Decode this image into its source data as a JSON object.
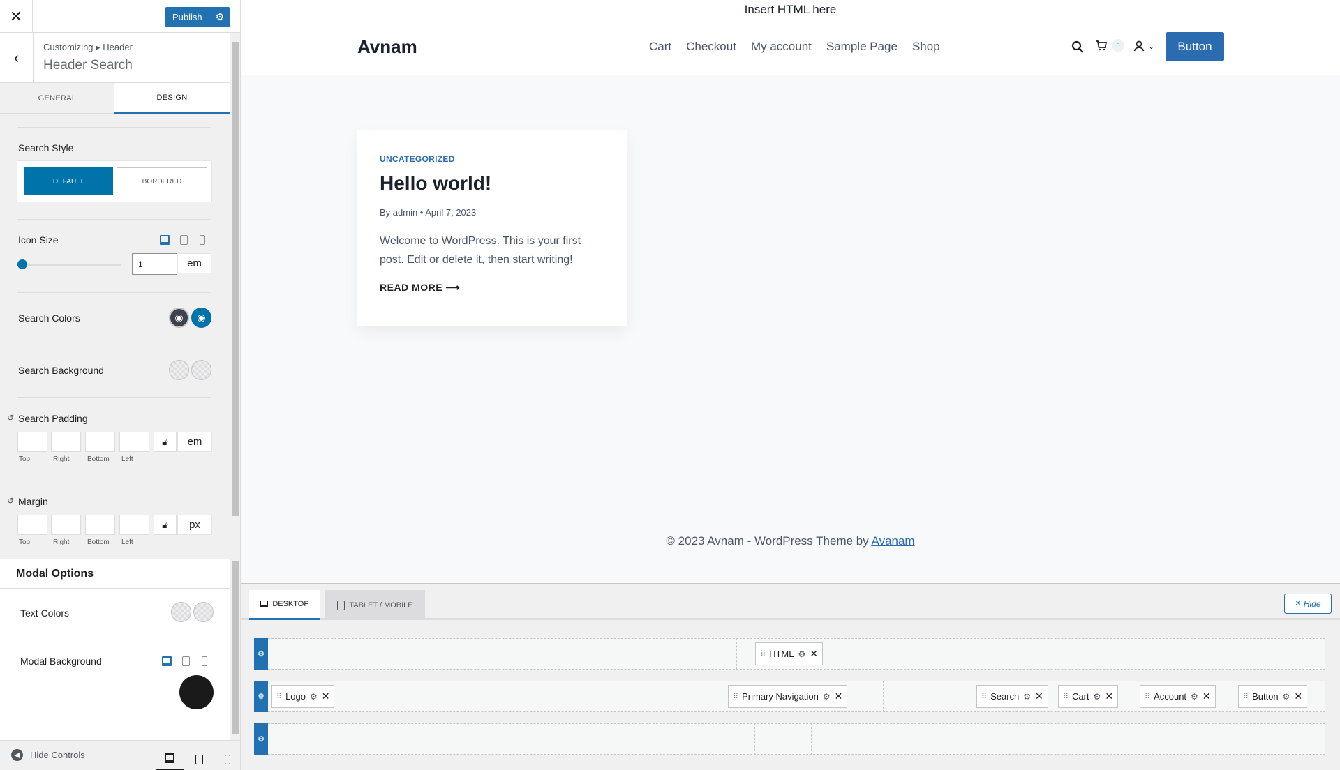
{
  "sidebar": {
    "close_icon": "close-icon",
    "publish_label": "Publish",
    "breadcrumb": "Customizing ▸ Header",
    "section_title": "Header Search",
    "tabs": [
      "GENERAL",
      "DESIGN"
    ],
    "search_style": {
      "label": "Search Style",
      "options": [
        "DEFAULT",
        "BORDERED"
      ],
      "selected": "DEFAULT"
    },
    "icon_size": {
      "label": "Icon Size",
      "value": "1",
      "unit": "em",
      "slider_fraction": 0.05
    },
    "search_colors_label": "Search Colors",
    "search_background_label": "Search Background",
    "search_padding": {
      "label": "Search Padding",
      "sides": [
        "Top",
        "Right",
        "Bottom",
        "Left"
      ],
      "unit": "em"
    },
    "margin": {
      "label": "Margin",
      "sides": [
        "Top",
        "Right",
        "Bottom",
        "Left"
      ],
      "unit": "px"
    },
    "modal_options": {
      "title": "Modal Options",
      "text_colors_label": "Text Colors",
      "modal_background_label": "Modal Background",
      "modal_background_color": "#1a1a1a"
    },
    "hide_controls_label": "Hide Controls"
  },
  "preview": {
    "top_html": "Insert HTML here",
    "logo": "Avnam",
    "nav": [
      "Cart",
      "Checkout",
      "My account",
      "Sample Page",
      "Shop"
    ],
    "cart_count": "0",
    "header_button": "Button",
    "post": {
      "category": "UNCATEGORIZED",
      "title": "Hello world!",
      "meta": "By admin  •  April 7, 2023",
      "excerpt": "Welcome to WordPress. This is your first post. Edit or delete it, then start writing!",
      "read_more": "READ MORE ⟶"
    },
    "footer_prefix": "© 2023 Avnam - WordPress Theme by ",
    "footer_link": "Avanam"
  },
  "builder": {
    "tabs": [
      "DESKTOP",
      "TABLET / MOBILE"
    ],
    "hide_label": "Hide",
    "top_row": [
      "HTML"
    ],
    "main_row": {
      "left": [
        "Logo"
      ],
      "center": [
        "Primary Navigation"
      ],
      "right": [
        "Search",
        "Cart",
        "Account",
        "Button"
      ]
    }
  },
  "colors": {
    "accent": "#2271b1",
    "button_blue": "#2b6cb0",
    "modal_bg": "#1a1a1a"
  }
}
